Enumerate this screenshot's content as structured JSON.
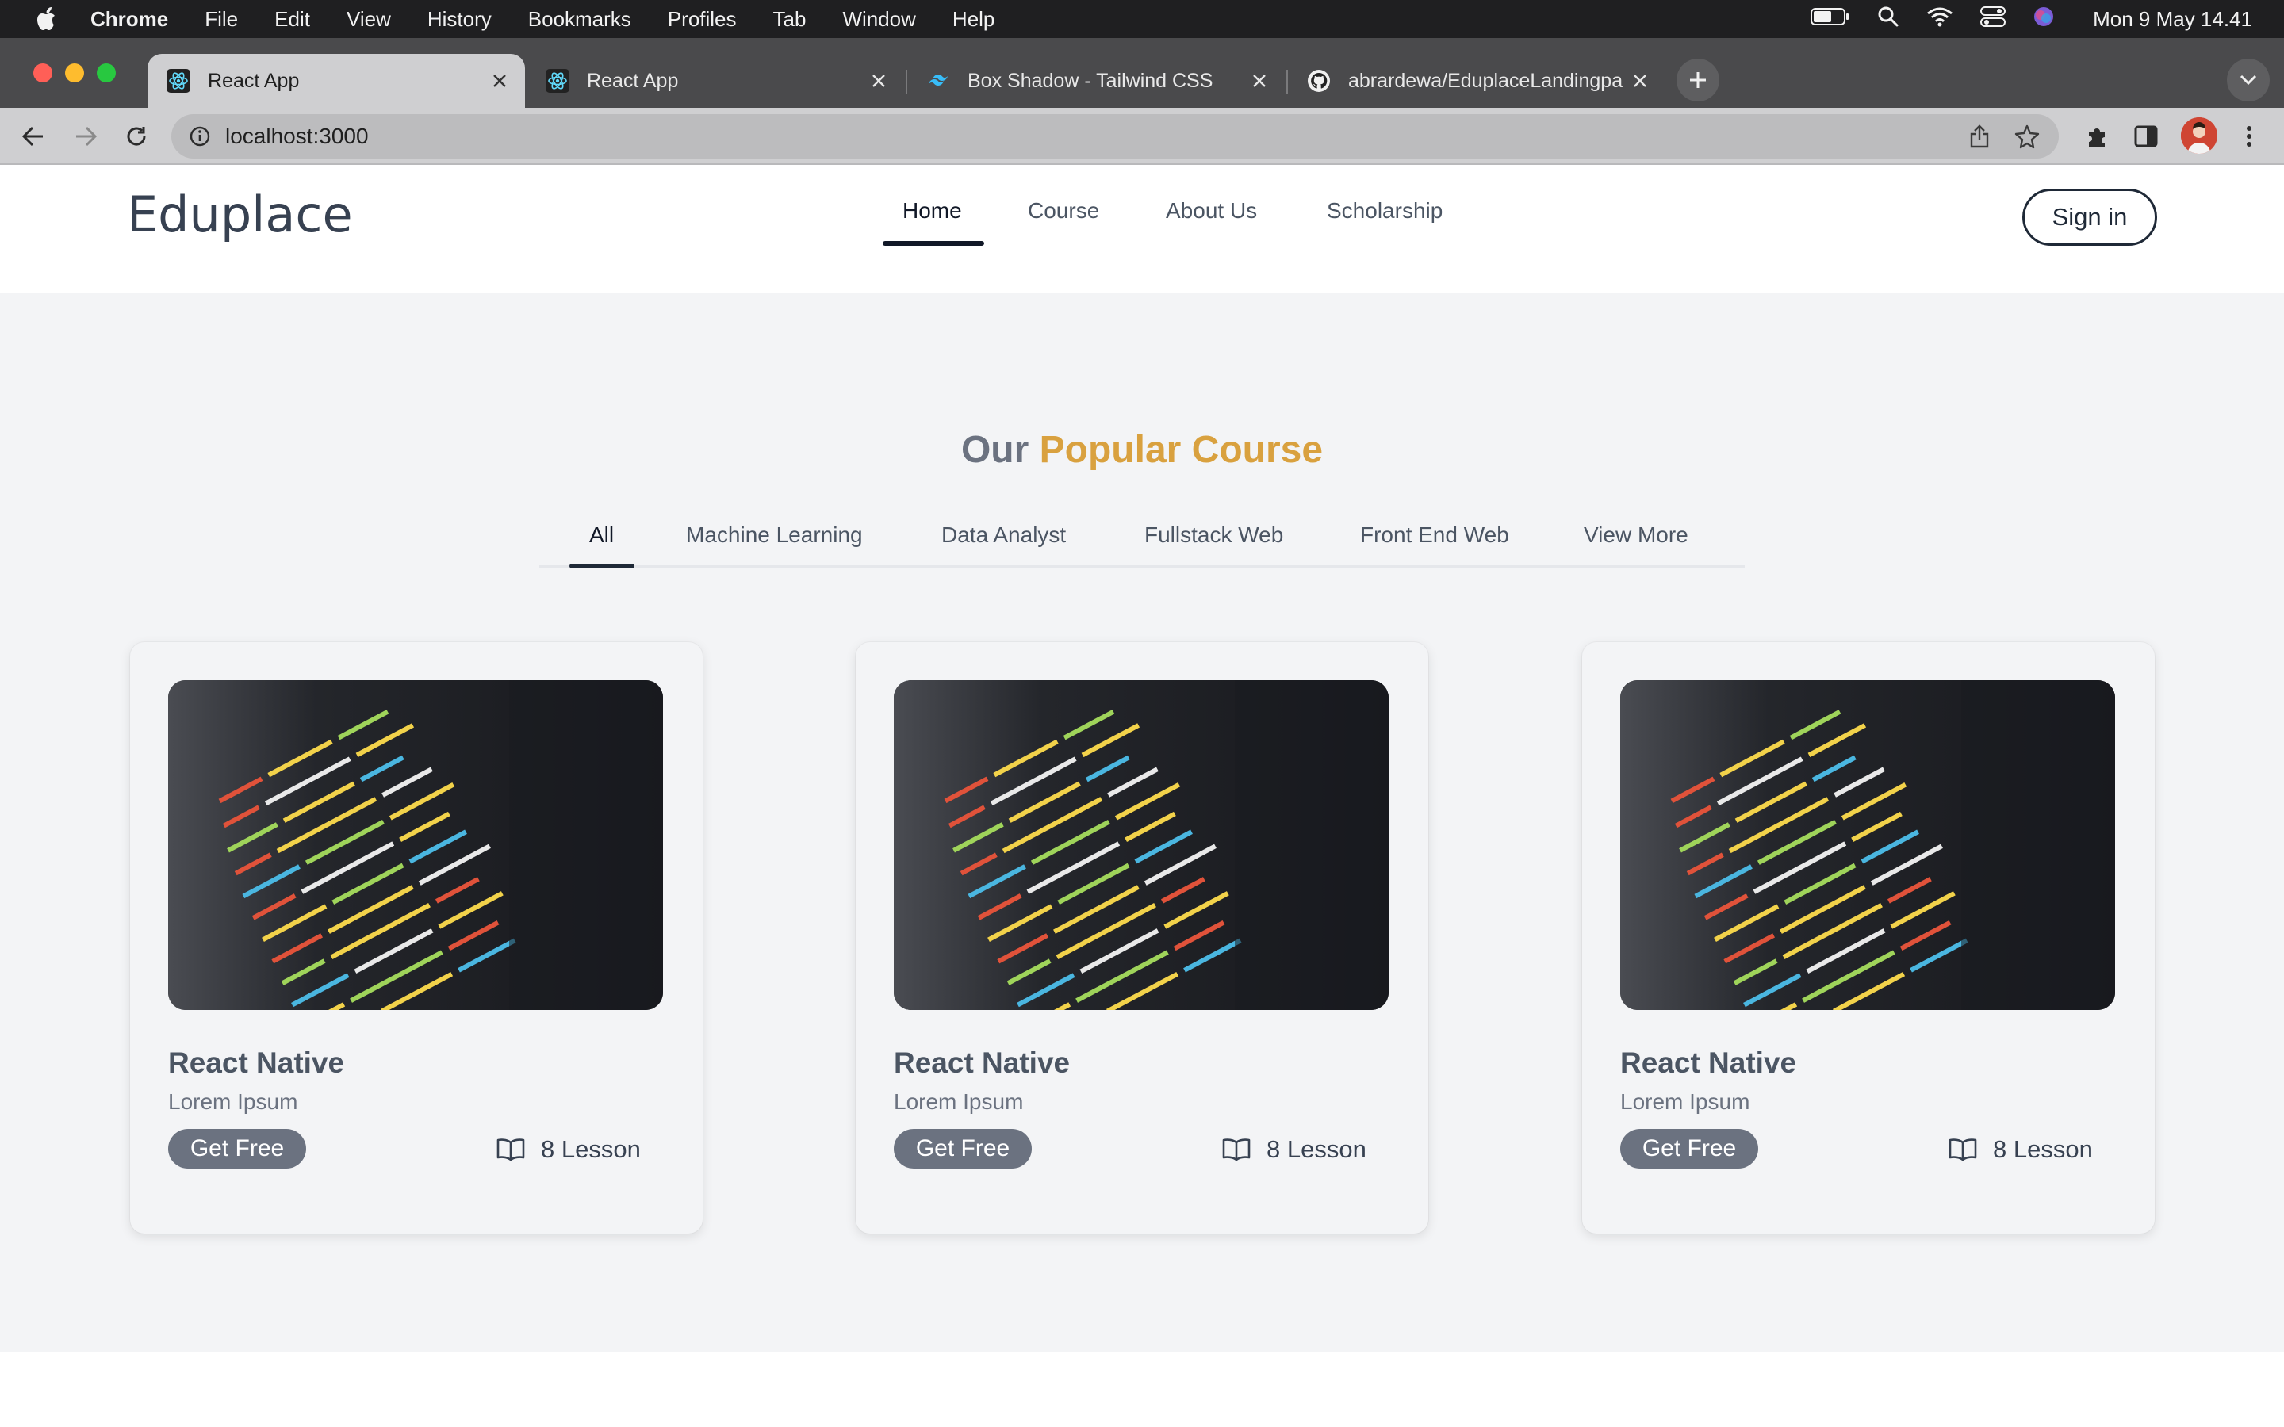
{
  "menubar": {
    "app_name": "Chrome",
    "items": [
      "File",
      "Edit",
      "View",
      "History",
      "Bookmarks",
      "Profiles",
      "Tab",
      "Window",
      "Help"
    ],
    "clock": "Mon 9 May  14.41"
  },
  "browser": {
    "tabs": [
      {
        "title": "React App",
        "icon": "react-icon"
      },
      {
        "title": "React App",
        "icon": "react-icon"
      },
      {
        "title": "Box Shadow - Tailwind CSS",
        "icon": "tailwind-icon"
      },
      {
        "title": "abrardewa/EduplaceLandingpa",
        "icon": "github-icon"
      }
    ],
    "url": "localhost:3000"
  },
  "site": {
    "logo": "Eduplace",
    "nav": [
      "Home",
      "Course",
      "About Us",
      "Scholarship"
    ],
    "signin_label": "Sign in"
  },
  "section": {
    "heading_part1": "Our",
    "heading_part2": "Popular Course",
    "tabs": [
      "All",
      "Machine Learning",
      "Data Analyst",
      "Fullstack Web",
      "Front End Web",
      "View More"
    ],
    "active_tab": "All"
  },
  "courses": [
    {
      "title": "React Native",
      "subtitle": "Lorem Ipsum",
      "cta": "Get Free",
      "lessons": "8 Lesson"
    },
    {
      "title": "React Native",
      "subtitle": "Lorem Ipsum",
      "cta": "Get Free",
      "lessons": "8 Lesson"
    },
    {
      "title": "React Native",
      "subtitle": "Lorem Ipsum",
      "cta": "Get Free",
      "lessons": "8 Lesson"
    }
  ],
  "colors": {
    "accent": "#d9a13f",
    "heading_gray": "#6b7280",
    "button_gray": "#6b7280",
    "page_bg": "#f3f4f6"
  }
}
